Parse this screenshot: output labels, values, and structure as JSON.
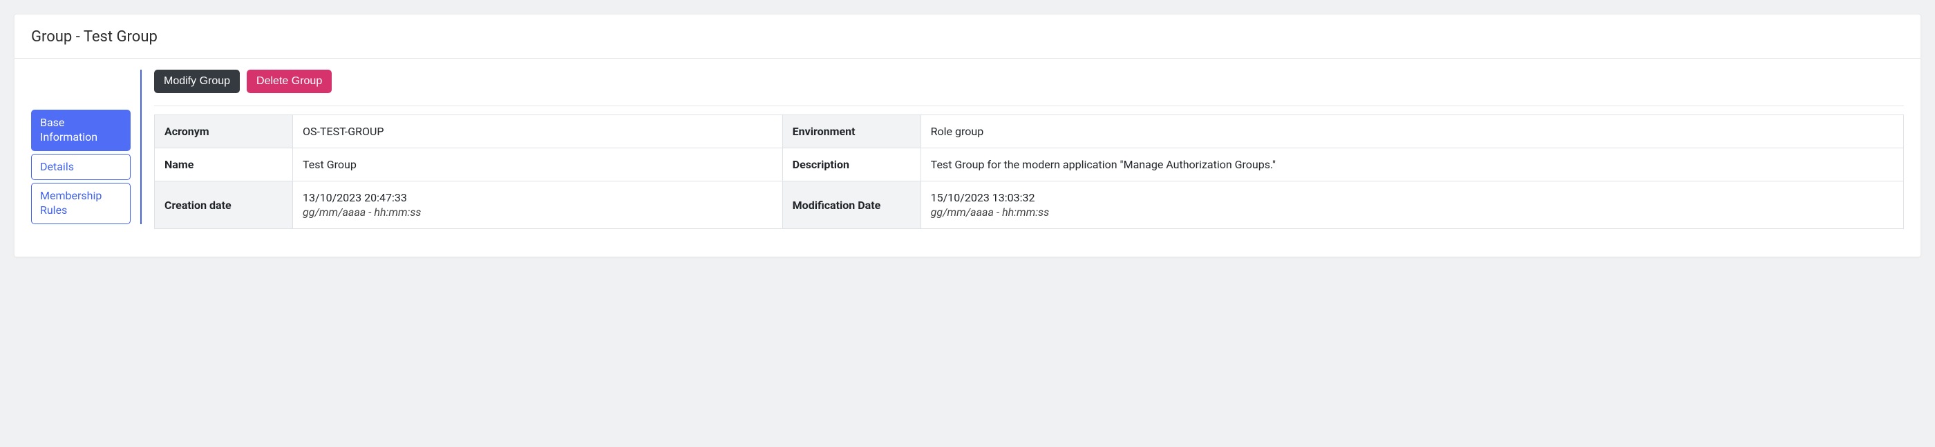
{
  "header": {
    "title": "Group - Test Group"
  },
  "nav": {
    "items": [
      {
        "label": "Base Information",
        "active": true
      },
      {
        "label": "Details",
        "active": false
      },
      {
        "label": "Membership Rules",
        "active": false
      }
    ]
  },
  "actions": {
    "modify": "Modify Group",
    "delete": "Delete Group"
  },
  "fields": {
    "acronym_label": "Acronym",
    "acronym_value": "OS-TEST-GROUP",
    "environment_label": "Environment",
    "environment_value": "Role group",
    "name_label": "Name",
    "name_value": "Test Group",
    "description_label": "Description",
    "description_value": "Test Group for the modern application \"Manage Authorization Groups.\"",
    "creation_label": "Creation date",
    "creation_value": "13/10/2023 20:47:33",
    "creation_format": "gg/mm/aaaa - hh:mm:ss",
    "modification_label": "Modification Date",
    "modification_value": "15/10/2023 13:03:32",
    "modification_format": "gg/mm/aaaa - hh:mm:ss"
  }
}
